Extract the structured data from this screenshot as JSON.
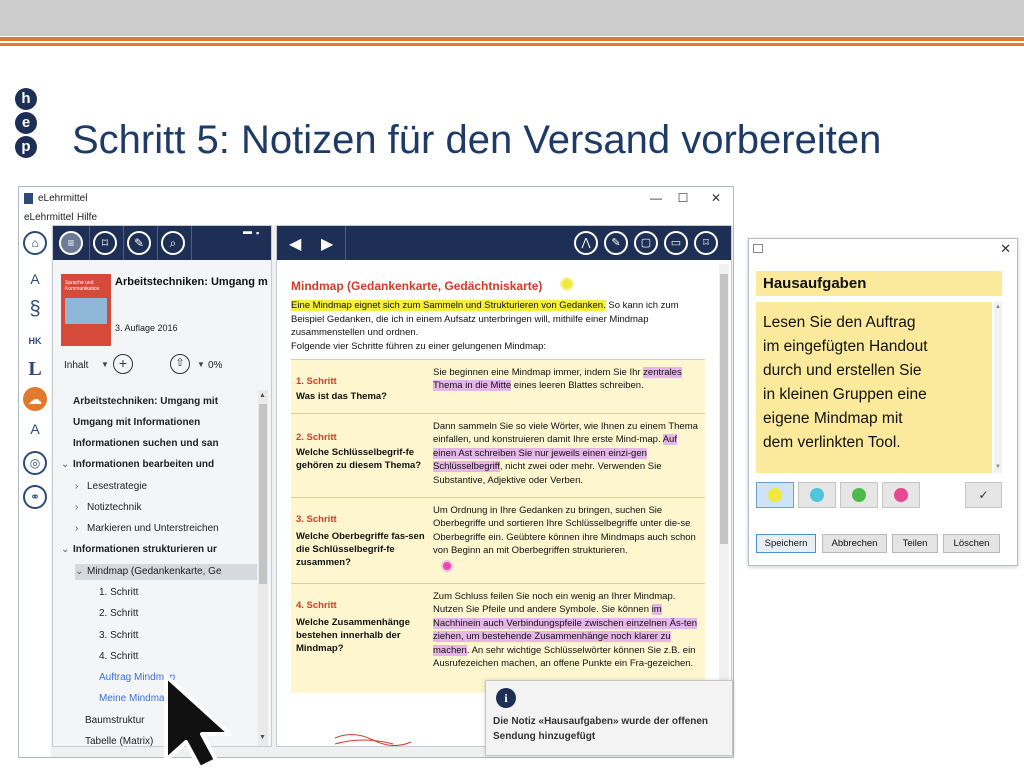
{
  "slide": {
    "title": "Schritt 5: Notizen für den Versand vorbereiten",
    "logo_letters": [
      "h",
      "e",
      "p"
    ]
  },
  "window": {
    "title": "eLehrmittel",
    "menu": [
      "eLehrmittel",
      "Hilfe"
    ],
    "controls": [
      "—",
      "☐",
      "✕"
    ]
  },
  "rail": [
    {
      "icon": "home-icon",
      "glyph": "⌂"
    },
    {
      "icon": "book-a-icon",
      "glyph": "A"
    },
    {
      "icon": "paragraph-icon",
      "glyph": "§"
    },
    {
      "icon": "hk-book-icon",
      "glyph": "HK"
    },
    {
      "icon": "letter-l-icon",
      "glyph": "L"
    },
    {
      "icon": "chat-icon",
      "glyph": "☁"
    },
    {
      "icon": "book-a2-icon",
      "glyph": "A"
    },
    {
      "icon": "globe-icon",
      "glyph": "◎"
    },
    {
      "icon": "share-network-icon",
      "glyph": "⚭"
    }
  ],
  "sidebar": {
    "book": {
      "cover_text": "Sprache und Kommunikation",
      "title": "Arbeitstechniken: Umgang m",
      "edition": "3. Auflage 2016"
    },
    "inhalt": "Inhalt",
    "progress": "0%",
    "toc": [
      {
        "label": "Arbeitstechniken: Umgang mit",
        "bold": true,
        "caret": ""
      },
      {
        "label": "Umgang mit Informationen",
        "bold": true,
        "caret": ""
      },
      {
        "label": "Informationen suchen und san",
        "bold": true,
        "caret": ""
      },
      {
        "label": "Informationen bearbeiten und",
        "bold": true,
        "caret": "⌄"
      },
      {
        "label": "Lesestrategie",
        "bold": false,
        "caret": "›"
      },
      {
        "label": "Notiztechnik",
        "bold": false,
        "caret": "›"
      },
      {
        "label": "Markieren und Unterstreichen",
        "bold": false,
        "caret": "›"
      },
      {
        "label": "Informationen strukturieren ur",
        "bold": true,
        "caret": "⌄"
      },
      {
        "label": "Mindmap (Gedankenkarte, Ge",
        "bold": false,
        "caret": "⌄",
        "selected": true
      },
      {
        "label": "1. Schritt",
        "bold": false,
        "caret": ""
      },
      {
        "label": "2. Schritt",
        "bold": false,
        "caret": ""
      },
      {
        "label": "3. Schritt",
        "bold": false,
        "caret": ""
      },
      {
        "label": "4. Schritt",
        "bold": false,
        "caret": ""
      },
      {
        "label": "Auftrag Mindmap",
        "bold": false,
        "caret": "",
        "link": true
      },
      {
        "label": "Meine Mindmap",
        "bold": false,
        "caret": "",
        "link": true
      },
      {
        "label": "Baumstruktur",
        "bold": false,
        "caret": ""
      },
      {
        "label": "Tabelle (Matrix)",
        "bold": false,
        "caret": ""
      }
    ]
  },
  "content": {
    "page_title": "Mindmap (Gedankenkarte, Gedächtniskarte)",
    "intro_highlight": "Eine Mindmap eignet sich zum Sammeln und Strukturieren von Gedanken.",
    "intro_rest": " So kann ich zum Beispiel Gedanken, die ich in einem Aufsatz unterbringen will, mithilfe einer Mindmap zusammenstellen und ordnen.",
    "intro_line2": "Folgende vier Schritte führen zu einer gelungenen Mindmap:",
    "steps": [
      {
        "num": "1. Schritt",
        "question": "Was ist das Thema?",
        "t1": "Sie beginnen eine Mindmap immer, indem Sie Ihr ",
        "hl": "zentrales Thema in die Mitte",
        "t2": " eines leeren Blattes schreiben."
      },
      {
        "num": "2. Schritt",
        "question": "Welche Schlüsselbegrif-fe gehören zu diesem Thema?",
        "t1": "Dann sammeln Sie so viele Wörter, wie Ihnen zu einem Thema einfallen, und konstruieren damit Ihre erste Mind-map. ",
        "hl": "Auf einen Ast schreiben Sie nur jeweils einen einzi-gen Schlüsselbegriff",
        "t2": ", nicht zwei oder mehr. Verwenden Sie Substantive, Adjektive oder Verben."
      },
      {
        "num": "3. Schritt",
        "question": "Welche Oberbegriffe fas-sen die Schlüsselbegrif-fe zusammen?",
        "t1": "Um Ordnung in Ihre Gedanken zu bringen, suchen Sie Oberbegriffe und sortieren Ihre Schlüsselbegriffe unter die-se Oberbegriffe ein. Geübtere können ihre Mindmaps auch schon von Beginn an mit Oberbegriffen strukturieren.",
        "hl": "",
        "t2": ""
      },
      {
        "num": "4. Schritt",
        "question": "Welche Zusammenhänge bestehen innerhalb der Mindmap?",
        "t1": "Zum Schluss feilen Sie noch ein wenig an Ihrer Mindmap. Nutzen Sie Pfeile und andere Symbole. Sie können ",
        "hl": "im Nachhinein auch Verbindungspfeile zwischen einzelnen Äs-ten ziehen, um bestehende Zusammenhänge noch klarer zu machen",
        "t2": ". An sehr wichtige Schlüsselwörter können Sie z.B. ein Ausrufezeichen machen, an offene Punkte ein Fra-gezeichen."
      }
    ]
  },
  "toast": {
    "message": "Die Notiz «Hausaufgaben» wurde der offenen Sendung hinzugefügt"
  },
  "note": {
    "title": "Hausaufgaben",
    "body": "Lesen Sie den Auftrag\nim eingefügten Handout\ndurch und erstellen Sie\nin kleinen Gruppen eine\neigene Mindmap mit\ndem verlinkten Tool.",
    "colors": [
      "#f2ea3a",
      "#4fc6dc",
      "#4cbb4a",
      "#e8488f"
    ],
    "buttons": {
      "save": "Speichern",
      "cancel": "Abbrechen",
      "share": "Teilen",
      "delete": "Löschen"
    }
  }
}
